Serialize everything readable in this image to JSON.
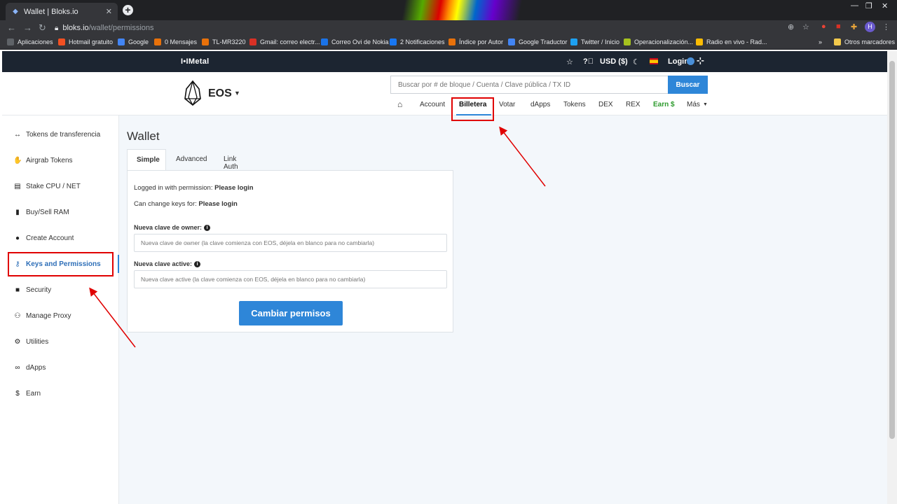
{
  "browser": {
    "tab_title": "Wallet | Bloks.io",
    "tab_close": "✕",
    "new_tab": "+",
    "url_host": "bloks.io",
    "url_path": "/wallet/permissions",
    "profile_initial": "H",
    "bookmarks": [
      {
        "label": "Aplicaciones",
        "color": "#5f6368"
      },
      {
        "label": "Hotmail gratuito",
        "color": "#f25022"
      },
      {
        "label": "Google",
        "color": "#4285f4"
      },
      {
        "label": "0 Mensajes",
        "color": "#e8710a"
      },
      {
        "label": "TL-MR3220",
        "color": "#e8710a"
      },
      {
        "label": "Gmail: correo electr...",
        "color": "#d93025"
      },
      {
        "label": "Correo Ovi de Nokia",
        "color": "#1a73e8"
      },
      {
        "label": "2 Notificaciones",
        "color": "#1877f2"
      },
      {
        "label": "Índice por Autor",
        "color": "#e8710a"
      },
      {
        "label": "Google Traductor",
        "color": "#4285f4"
      },
      {
        "label": "Twitter / Inicio",
        "color": "#1da1f2"
      },
      {
        "label": "Operacionalización...",
        "color": "#a6c21e"
      },
      {
        "label": "Radio en vivo - Rad...",
        "color": "#fbbc04"
      }
    ],
    "bookmarks_more": "»",
    "other_bookmarks": "Otros marcadores"
  },
  "topbar": {
    "brand": "I•IMetal",
    "currency": "USD ($)",
    "login": "Login"
  },
  "header": {
    "chain": "EOS",
    "search_placeholder": "Buscar por # de bloque / Cuenta / Clave pública / TX ID",
    "search_button": "Buscar",
    "nav": [
      "Account",
      "Billetera",
      "Votar",
      "dApps",
      "Tokens",
      "DEX",
      "REX",
      "Earn $",
      "Más"
    ]
  },
  "sidebar": {
    "items": [
      {
        "label": "Tokens de transferencia",
        "icon": "↔"
      },
      {
        "label": "Airgrab Tokens",
        "icon": "✋"
      },
      {
        "label": "Stake CPU / NET",
        "icon": "▤"
      },
      {
        "label": "Buy/Sell RAM",
        "icon": "▮"
      },
      {
        "label": "Create Account",
        "icon": "●"
      },
      {
        "label": "Keys and Permissions",
        "icon": "⚷"
      },
      {
        "label": "Security",
        "icon": "■"
      },
      {
        "label": "Manage Proxy",
        "icon": "⚇"
      },
      {
        "label": "Utilities",
        "icon": "⚙"
      },
      {
        "label": "dApps",
        "icon": "∞"
      },
      {
        "label": "Earn",
        "icon": "$"
      }
    ]
  },
  "main": {
    "title": "Wallet",
    "tabs": [
      "Simple",
      "Advanced",
      "Link Auth"
    ],
    "logged_in_label": "Logged in with permission: ",
    "logged_in_value": "Please login",
    "change_keys_label": "Can change keys for: ",
    "change_keys_value": "Please login",
    "owner_label": "Nueva clave de owner:",
    "owner_placeholder": "Nueva clave de owner (la clave comienza con EOS, déjela en blanco para no cambiarla)",
    "active_label": "Nueva clave active:",
    "active_placeholder": "Nueva clave active (la clave comienza con EOS, déjela en blanco para no cambiarla)",
    "submit": "Cambiar permisos"
  },
  "colors": {
    "accent": "#2e86d8",
    "topbar": "#1c2531",
    "earn": "#2e9b2e",
    "annotation": "#e00000"
  }
}
